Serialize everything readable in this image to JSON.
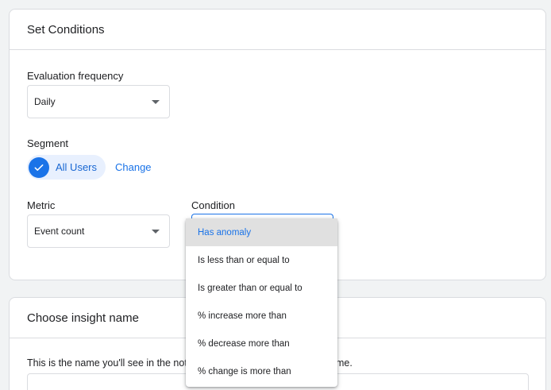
{
  "conditions": {
    "title": "Set Conditions",
    "frequency_label": "Evaluation frequency",
    "frequency_value": "Daily",
    "segment_label": "Segment",
    "segment_value": "All Users",
    "segment_change": "Change",
    "metric_label": "Metric",
    "metric_value": "Event count",
    "condition_label": "Condition"
  },
  "condition_menu": {
    "options": [
      "Has anomaly",
      "Is less than or equal to",
      "Is greater than or equal to",
      "% increase more than",
      "% decrease more than",
      "% change is more than"
    ],
    "selected": "Has anomaly"
  },
  "insight": {
    "title": "Choose insight name",
    "description_start": "This is the name you'll see in the not",
    "description_end": "me."
  },
  "colors": {
    "accent": "#1a73e8",
    "chip_bg": "#e8f0fe",
    "selected_bg": "#e0e0e0"
  }
}
